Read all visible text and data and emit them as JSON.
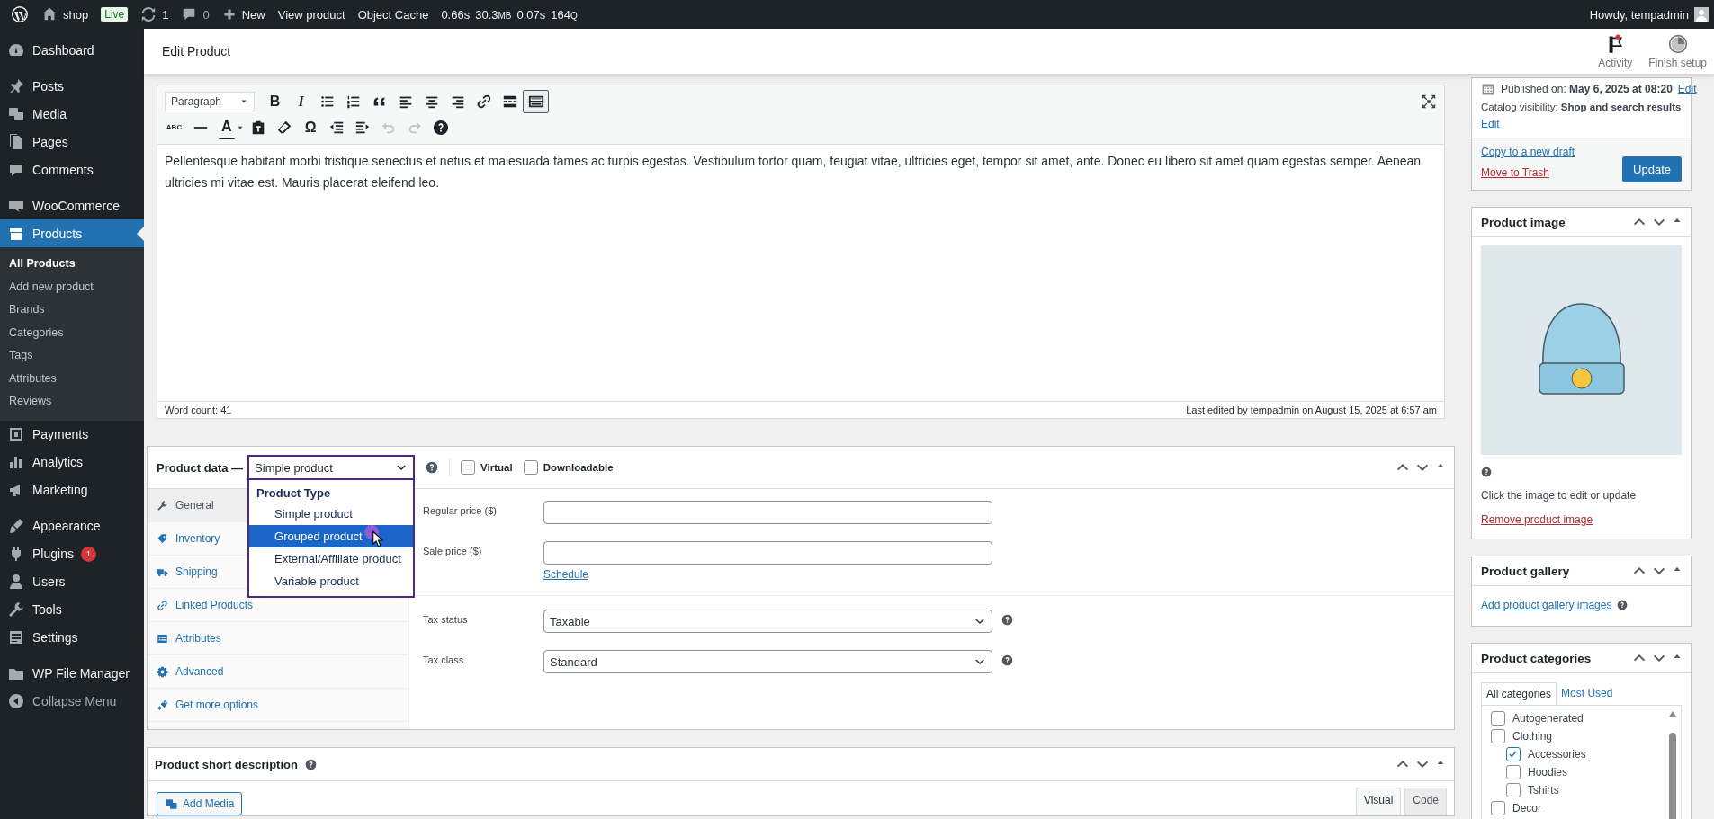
{
  "admin_bar": {
    "site": "shop",
    "badge": "Live",
    "updates": "1",
    "comments": "0",
    "new": "New",
    "links": [
      "View product",
      "Object Cache"
    ],
    "stats": [
      {
        "value": "0.66s"
      },
      {
        "value": "30.3",
        "unit": "MB"
      },
      {
        "value": "0.07s"
      },
      {
        "value": "164",
        "unit": "Q"
      }
    ],
    "greeting": "Howdy, tempadmin"
  },
  "sidebar": {
    "groups": [
      [
        {
          "label": "Dashboard",
          "selected": false
        }
      ],
      [
        {
          "label": "Posts",
          "selected": false
        },
        {
          "label": "Media",
          "selected": false
        },
        {
          "label": "Pages",
          "selected": false
        },
        {
          "label": "Comments",
          "selected": false
        }
      ],
      [
        {
          "label": "WooCommerce",
          "selected": false
        },
        {
          "label": "Products",
          "selected": true,
          "children": [
            {
              "label": "All Products",
              "selected": true
            },
            {
              "label": "Add new product",
              "selected": false
            },
            {
              "label": "Brands",
              "selected": false
            },
            {
              "label": "Categories",
              "selected": false
            },
            {
              "label": "Tags",
              "selected": false
            },
            {
              "label": "Attributes",
              "selected": false
            },
            {
              "label": "Reviews",
              "selected": false
            }
          ]
        },
        {
          "label": "Payments",
          "selected": false
        },
        {
          "label": "Analytics",
          "selected": false
        },
        {
          "label": "Marketing",
          "selected": false
        }
      ],
      [
        {
          "label": "Appearance",
          "selected": false
        },
        {
          "label": "Plugins",
          "selected": false,
          "badge": "1"
        },
        {
          "label": "Users",
          "selected": false
        },
        {
          "label": "Tools",
          "selected": false
        },
        {
          "label": "Settings",
          "selected": false
        }
      ],
      [
        {
          "label": "WP File Manager",
          "selected": false
        },
        {
          "label": "Collapse Menu",
          "selected": false
        }
      ]
    ]
  },
  "header": {
    "title": "Edit Product",
    "actions": [
      "Activity",
      "Finish setup"
    ]
  },
  "editor": {
    "format": "Paragraph",
    "toolbar": [
      [
        {
          "kind": "bold",
          "glyph": "B",
          "active": false,
          "disabled": false
        },
        {
          "kind": "italic",
          "glyph": "I",
          "active": false,
          "disabled": false
        },
        {
          "kind": "bullets",
          "active": false,
          "disabled": false
        },
        {
          "kind": "numbers",
          "active": false,
          "disabled": false
        },
        {
          "kind": "quote",
          "active": false,
          "disabled": false
        },
        {
          "kind": "align-left",
          "active": false,
          "disabled": false
        },
        {
          "kind": "align-center",
          "active": false,
          "disabled": false
        },
        {
          "kind": "align-right",
          "active": false,
          "disabled": false
        },
        {
          "kind": "link",
          "active": false,
          "disabled": false
        },
        {
          "kind": "more",
          "active": false,
          "disabled": false
        },
        {
          "kind": "toggle",
          "active": true,
          "disabled": false
        }
      ],
      [
        {
          "kind": "strike",
          "glyph": "ABC",
          "active": false,
          "disabled": false
        },
        {
          "kind": "hr",
          "active": false,
          "disabled": false
        },
        {
          "kind": "text-color",
          "glyph": "A",
          "active": false,
          "disabled": false
        },
        {
          "kind": "paste",
          "active": false,
          "disabled": false
        },
        {
          "kind": "eraser",
          "active": false,
          "disabled": false
        },
        {
          "kind": "special",
          "glyph": "Ω",
          "active": false,
          "disabled": false
        },
        {
          "kind": "outdent",
          "active": false,
          "disabled": false
        },
        {
          "kind": "indent",
          "active": false,
          "disabled": false
        },
        {
          "kind": "undo",
          "active": false,
          "disabled": true
        },
        {
          "kind": "redo",
          "active": false,
          "disabled": true
        },
        {
          "kind": "help",
          "active": false,
          "disabled": false
        }
      ]
    ],
    "content": "Pellentesque habitant morbi tristique senectus et netus et malesuada fames ac turpis egestas. Vestibulum tortor quam, feugiat vitae, ultricies eget, tempor sit amet, ante. Donec eu libero sit amet quam egestas semper. Aenean ultricies mi vitae est. Mauris placerat eleifend leo.",
    "word_count": "Word count: 41",
    "last_edited": "Last edited by tempadmin on August 15, 2025 at 6:57 am"
  },
  "product_data": {
    "label": "Product data —",
    "type_select": "Simple product",
    "type_menu": {
      "group": "Product Type",
      "options": [
        {
          "label": "Simple product",
          "selected": false
        },
        {
          "label": "Grouped product",
          "selected": true
        },
        {
          "label": "External/Affiliate product",
          "selected": false
        },
        {
          "label": "Variable product",
          "selected": false
        }
      ]
    },
    "checkboxes": [
      {
        "label": "Virtual",
        "checked": false
      },
      {
        "label": "Downloadable",
        "checked": false
      }
    ],
    "tabs": [
      {
        "label": "General",
        "selected": true
      },
      {
        "label": "Inventory",
        "selected": false
      },
      {
        "label": "Shipping",
        "selected": false
      },
      {
        "label": "Linked Products",
        "selected": false
      },
      {
        "label": "Attributes",
        "selected": false
      },
      {
        "label": "Advanced",
        "selected": false
      },
      {
        "label": "Get more options",
        "selected": false
      }
    ],
    "prices": [
      {
        "label": "Regular price ($)"
      },
      {
        "label": "Sale price ($)",
        "link": "Schedule"
      }
    ],
    "tax": [
      {
        "label": "Tax status",
        "value": "Taxable"
      },
      {
        "label": "Tax class",
        "value": "Standard"
      }
    ]
  },
  "short_description": {
    "title": "Product short description",
    "add_media": "Add Media",
    "tabs": [
      {
        "label": "Visual",
        "selected": true
      },
      {
        "label": "Code",
        "selected": false
      }
    ]
  },
  "publish": {
    "published": "Published on: **May 6, 2025 at 08:20**",
    "edit": "Edit",
    "visibility": "Catalog visibility: **Shop and search results**",
    "visibility_edit": "Edit",
    "copy": "Copy to a new draft",
    "trash": "Move to Trash",
    "update": "Update"
  },
  "product_image": {
    "title": "Product image",
    "hint": "Click the image to edit or update",
    "remove": "Remove product image"
  },
  "gallery": {
    "title": "Product gallery",
    "link": "Add product gallery images"
  },
  "categories": {
    "title": "Product categories",
    "tabs": [
      {
        "label": "All categories",
        "selected": true
      },
      {
        "label": "Most Used",
        "selected": false
      }
    ],
    "items": [
      {
        "label": "Autogenerated",
        "checked": false
      },
      {
        "label": "Clothing",
        "checked": false,
        "children": [
          {
            "label": "Accessories",
            "checked": true
          },
          {
            "label": "Hoodies",
            "checked": false
          },
          {
            "label": "Tshirts",
            "checked": false
          }
        ]
      },
      {
        "label": "Decor",
        "checked": false
      }
    ]
  }
}
